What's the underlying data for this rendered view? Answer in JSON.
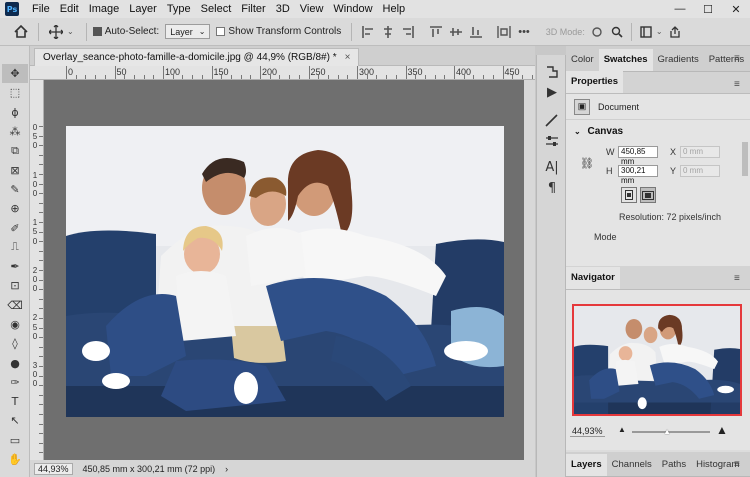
{
  "app": {
    "logo": "Ps"
  },
  "menu": [
    "File",
    "Edit",
    "Image",
    "Layer",
    "Type",
    "Select",
    "Filter",
    "3D",
    "View",
    "Window",
    "Help"
  ],
  "window_controls": {
    "minimize": "—",
    "maximize": "☐",
    "close": "✕"
  },
  "options": {
    "auto_select_label": "Auto-Select:",
    "auto_select_checked": true,
    "layer_select": "Layer",
    "show_transform_label": "Show Transform Controls",
    "show_transform_checked": false,
    "mode_3d": "3D Mode:"
  },
  "document": {
    "tab_title": "Overlay_seance-photo-famille-a-domicile.jpg @ 44,9% (RGB/8#) *",
    "close": "×"
  },
  "ruler": {
    "top_labels": [
      "0",
      "50",
      "100",
      "150",
      "200",
      "250",
      "300",
      "350",
      "400",
      "450"
    ],
    "left_labels": [
      "0",
      "5",
      "0",
      "1",
      "0",
      "0",
      "1",
      "5",
      "0",
      "2",
      "0",
      "0",
      "2",
      "5",
      "0",
      "3",
      "0",
      "0"
    ]
  },
  "status": {
    "zoom": "44,93%",
    "dimensions": "450,85 mm x 300,21 mm (72 ppi)",
    "arrow": "›"
  },
  "tools": [
    "✥",
    "⬚",
    "ϕ",
    "⁂",
    "⧉",
    "⊠",
    "✎",
    "⊕",
    "✐",
    "⎍",
    "✒",
    "⊡",
    "⌫",
    "◉",
    "◊",
    "●",
    "✑",
    "T",
    "↖",
    "▭",
    "✋",
    "⌕"
  ],
  "panel_tabs_top": [
    {
      "label": "Color",
      "active": false
    },
    {
      "label": "Swatches",
      "active": true
    },
    {
      "label": "Gradients",
      "active": false
    },
    {
      "label": "Patterns",
      "active": false
    }
  ],
  "properties": {
    "tab": "Properties",
    "doc_label": "Document",
    "canvas_title": "Canvas",
    "w_label": "W",
    "w_value": "450,85 mm",
    "h_label": "H",
    "h_value": "300,21 mm",
    "x_label": "X",
    "x_value": "0 mm",
    "y_label": "Y",
    "y_value": "0 mm",
    "resolution": "Resolution: 72 pixels/inch",
    "mode_label": "Mode"
  },
  "navigator": {
    "tab": "Navigator",
    "zoom": "44,93%",
    "zoom_level": 0.45
  },
  "bottom_tabs": [
    {
      "label": "Layers",
      "active": true
    },
    {
      "label": "Channels",
      "active": false
    },
    {
      "label": "Paths",
      "active": false
    },
    {
      "label": "Histogram",
      "active": false
    }
  ],
  "colors": {
    "nav_frame": "#e5383b",
    "sofa": "#233a63",
    "jeans": "#2d4c85"
  }
}
